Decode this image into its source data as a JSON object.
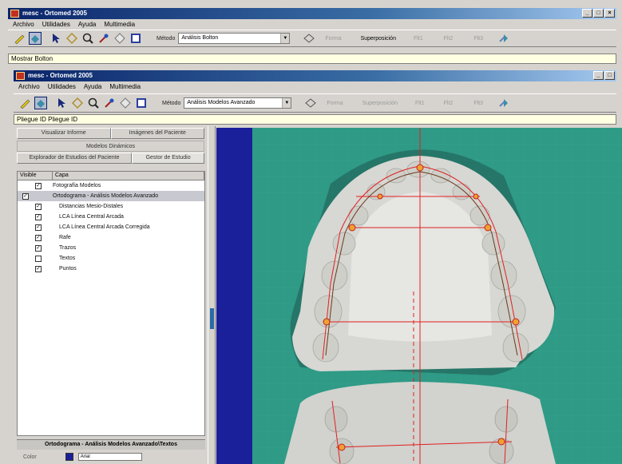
{
  "back_window": {
    "title": "mesc - Ortomed 2005",
    "menu": [
      "Archivo",
      "Utilidades",
      "Ayuda",
      "Multimedia"
    ],
    "toolbar": {
      "metodo_label": "Método",
      "metodo_value": "Análisis Bolton",
      "dim_buttons": [
        "Forma",
        "Superposición",
        "Flt1",
        "Flt2",
        "Flt3"
      ]
    },
    "info_text": "Mostrar Bolton"
  },
  "front_window": {
    "title": "mesc - Ortomed 2005",
    "menu": [
      "Archivo",
      "Utilidades",
      "Ayuda",
      "Multimedia"
    ],
    "toolbar": {
      "metodo_label": "Método",
      "metodo_value": "Análisis Modelos Avanzado",
      "dim_buttons": [
        "Forma",
        "Superposición",
        "Flt1",
        "Flt2",
        "Flt3"
      ]
    },
    "info_text": "Pliegue ID  Pliegue ID"
  },
  "left_panel": {
    "tabs_row1": [
      "Visualizar Informe",
      "Imágenes del Paciente"
    ],
    "section_title": "Modelos Dinámicos",
    "tabs_row2": [
      "Explorador de Estudios del Paciente",
      "Gestor de Estudio"
    ],
    "columns": [
      "Visible",
      "Capa"
    ],
    "layers": [
      {
        "label": "Fotografía Modelos",
        "checked": true,
        "indent": 0,
        "group": false
      },
      {
        "label": "Ortodograma - Análisis Modelos Avanzado",
        "checked": true,
        "indent": 0,
        "group": true
      },
      {
        "label": "Distancias Mesio-Distales",
        "checked": true,
        "indent": 1,
        "group": false
      },
      {
        "label": "LCA Línea Central Arcada",
        "checked": true,
        "indent": 1,
        "group": false
      },
      {
        "label": "LCA Línea Central Arcada Corregida",
        "checked": true,
        "indent": 1,
        "group": false
      },
      {
        "label": "Rafe",
        "checked": true,
        "indent": 1,
        "group": false
      },
      {
        "label": "Trazos",
        "checked": true,
        "indent": 1,
        "group": false
      },
      {
        "label": "Textos",
        "checked": false,
        "indent": 1,
        "group": false
      },
      {
        "label": "Puntos",
        "checked": true,
        "indent": 1,
        "group": false
      }
    ],
    "footer_title": "Ortodograma - Análisis Modelos Avanzado\\Textos",
    "footer_color_label": "Color",
    "footer_value": "Arial"
  },
  "colors": {
    "title_blue": "#0a246a",
    "canvas_green": "#2f9a86",
    "trace_red": "#e02020",
    "band_blue": "#1a1f9a"
  }
}
